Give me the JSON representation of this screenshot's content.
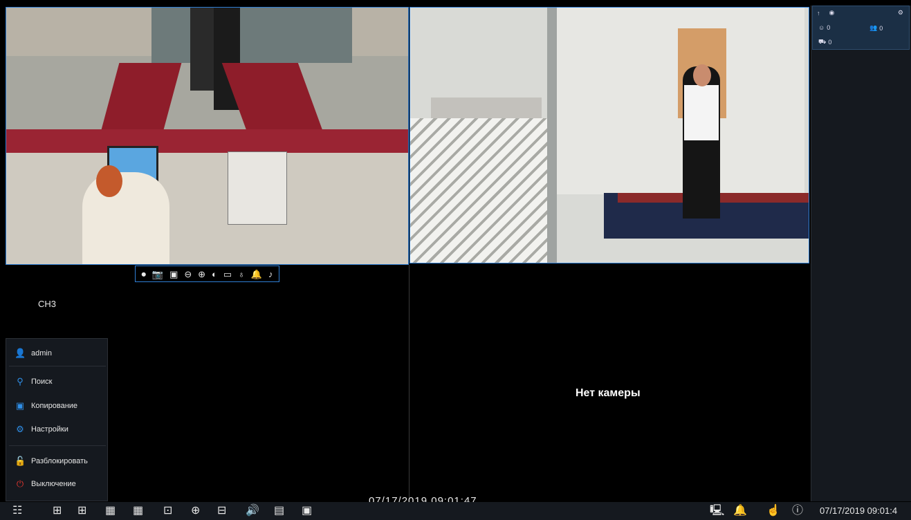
{
  "channels": {
    "ch3_label": "CH3",
    "ch4_status": "Нет камеры"
  },
  "stats": {
    "face_count": "0",
    "people_count": "0",
    "vehicle_count": "0"
  },
  "menu": {
    "user": "admin",
    "items": [
      {
        "label": "Поиск",
        "icon": "search-icon"
      },
      {
        "label": "Копирование",
        "icon": "backup-icon"
      },
      {
        "label": "Настройки",
        "icon": "settings-icon"
      },
      {
        "label": "Разблокировать",
        "icon": "unlock-icon"
      },
      {
        "label": "Выключение",
        "icon": "power-icon"
      }
    ]
  },
  "taskbar": {
    "overlay_time": "07/17/2019 09:01:47",
    "clock": "07/17/2019 09:01:4"
  },
  "colors": {
    "accent": "#2f7fd6",
    "panel": "#15191f",
    "power": "#e0342e"
  }
}
